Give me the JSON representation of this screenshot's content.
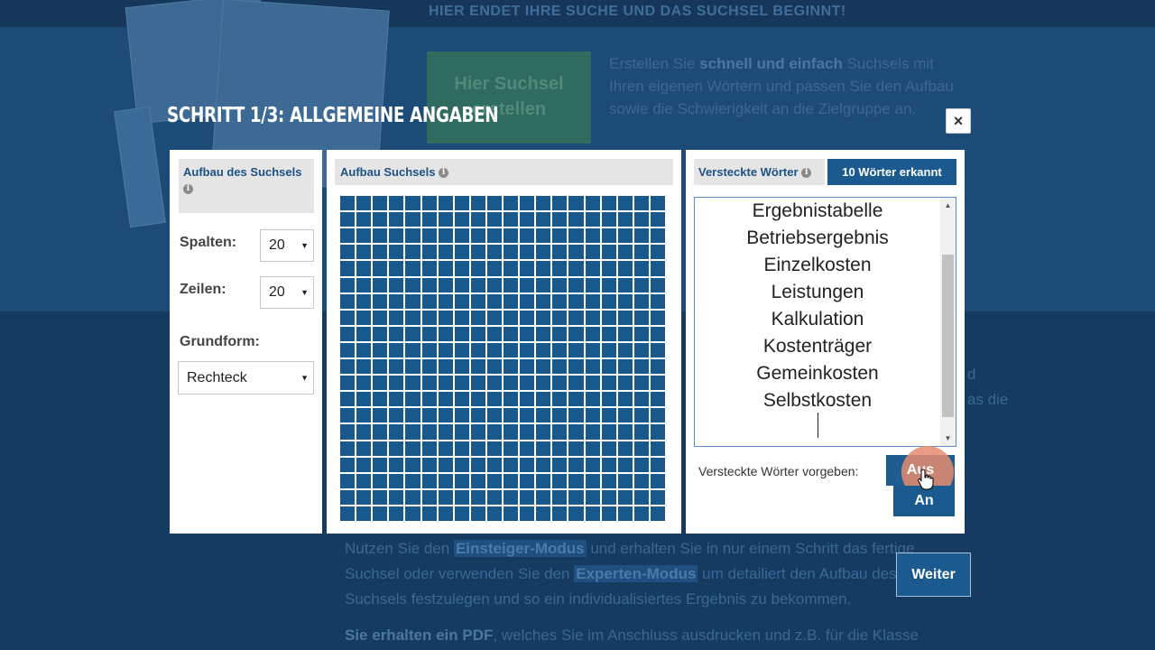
{
  "background": {
    "header_text": "HIER ENDET IHRE SUCHE UND DAS SUCHSEL BEGINNT!",
    "cta_button": "Hier Suchsel erstellen",
    "intro_text_1": "Erstellen Sie ",
    "intro_bold": "schnell und einfach",
    "intro_text_2": " Suchsels mit Ihren eigenen Wörtern und passen Sie den Aufbau sowie die Schwierigkeit an die Zielgruppe an.",
    "lower_line_1a": "Nutzen Sie den ",
    "lower_link_1": "Einsteiger-Modus",
    "lower_line_1b": " und erhalten Sie in nur einem Schritt das fertige",
    "lower_line_2a": "Suchsel oder verwenden Sie den ",
    "lower_link_2": "Experten-Modus",
    "lower_line_2b": " um detailiert den Aufbau des",
    "lower_line_3": "Suchsels festzulegen und so ein individualisiertes Ergebnis zu bekommen.",
    "lower_line_4_bold": "Sie erhalten ein PDF",
    "lower_line_4": ", welches Sie im Anschluss ausdrucken und z.B. für die Klasse",
    "right_frag_1": "d",
    "right_frag_2": "as die"
  },
  "modal": {
    "title": "Schritt 1/3: Allgemeine Angaben",
    "close_label": "×",
    "left_panel": {
      "heading": "Aufbau des Suchsels",
      "spalten_label": "Spalten:",
      "spalten_value": "20",
      "zeilen_label": "Zeilen:",
      "zeilen_value": "20",
      "grundform_label": "Grundform:",
      "grundform_value": "Rechteck"
    },
    "mid_panel": {
      "heading": "Aufbau Suchsels",
      "grid_columns": 20,
      "grid_rows": 20
    },
    "right_panel": {
      "heading": "Versteckte Wörter",
      "badge": "10 Wörter erkannt",
      "words": [
        "Ergebnistabelle",
        "Betriebsergebnis",
        "Einzelkosten",
        "Leistungen",
        "Kalkulation",
        "Kostenträger",
        "Gemeinkosten",
        "Selbstkosten"
      ],
      "vorgeben_label": "Versteckte Wörter vorgeben:",
      "toggle_off": "Aus",
      "toggle_on": "An"
    },
    "next_button": "Weiter"
  },
  "colors": {
    "accent": "#1a5a8f",
    "grid_cell": "#18588d",
    "heading_text": "#1d5285"
  }
}
